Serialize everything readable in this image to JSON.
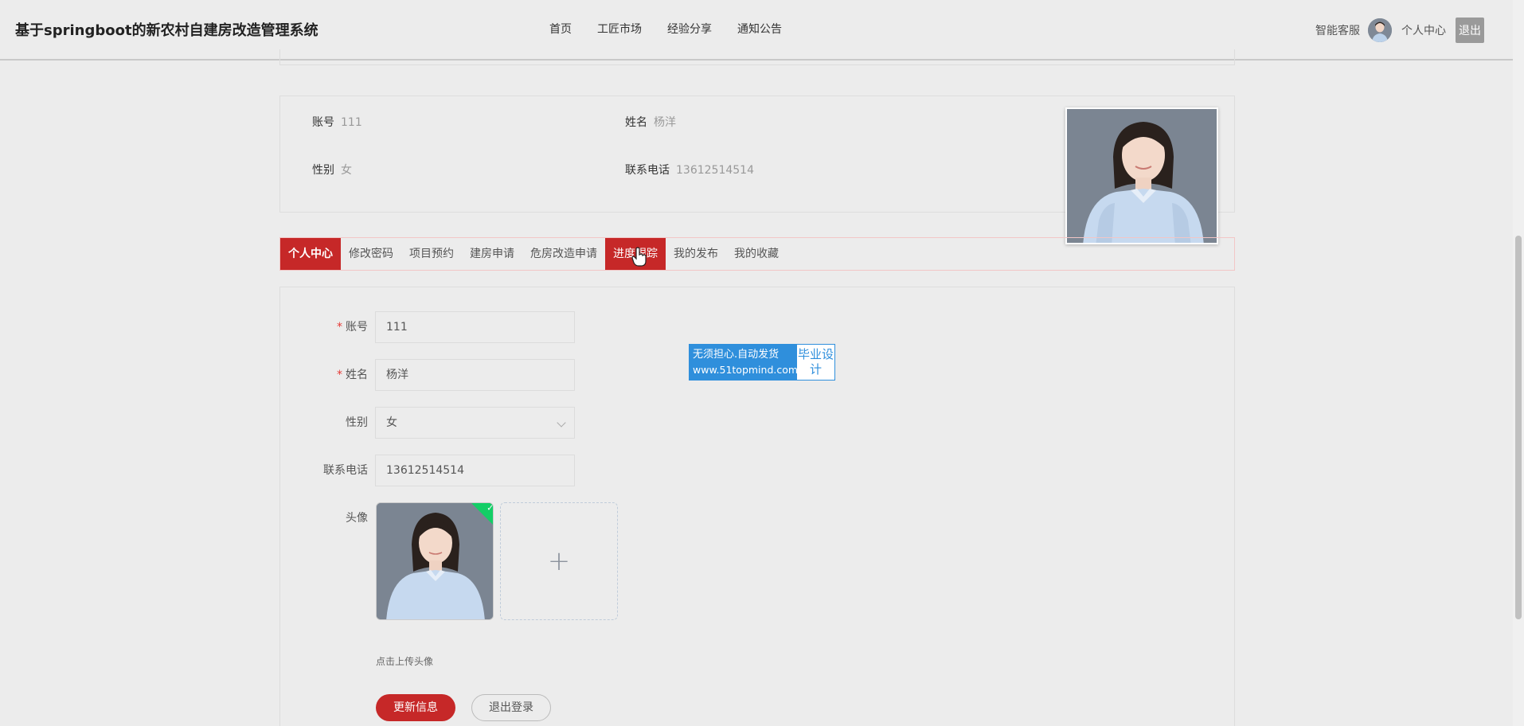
{
  "header": {
    "site_title": "基于springboot的新农村自建房改造管理系统",
    "nav": [
      "首页",
      "工匠市场",
      "经验分享",
      "通知公告"
    ],
    "right": {
      "service": "智能客服",
      "center": "个人中心",
      "logout": "退出"
    }
  },
  "info": {
    "account_label": "账号",
    "account_value": "111",
    "name_label": "姓名",
    "name_value": "杨洋",
    "gender_label": "性别",
    "gender_value": "女",
    "phone_label": "联系电话",
    "phone_value": "13612514514"
  },
  "tabs": [
    "个人中心",
    "修改密码",
    "项目预约",
    "建房申请",
    "危房改造申请",
    "进度跟踪",
    "我的发布",
    "我的收藏"
  ],
  "form": {
    "account_label": "账号",
    "account_value": "111",
    "name_label": "姓名",
    "name_value": "杨洋",
    "gender_label": "性别",
    "gender_value": "女",
    "phone_label": "联系电话",
    "phone_value": "13612514514",
    "avatar_label": "头像",
    "upload_tip": "点击上传头像",
    "update_button": "更新信息",
    "logout_button": "退出登录"
  },
  "watermark": {
    "line1": "无须担心.自动发货",
    "line2": "www.51topmind.com",
    "side": "毕业设计"
  },
  "colors": {
    "accent": "#c62828",
    "watermark": "#2f8fdc",
    "success": "#13ce66"
  }
}
